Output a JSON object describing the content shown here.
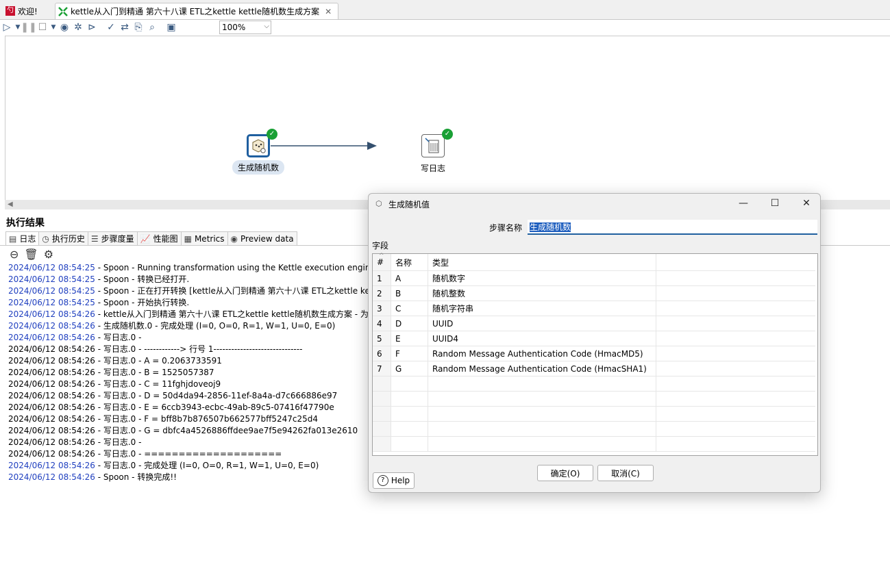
{
  "tabs": {
    "welcome": "欢迎!",
    "transformation": "kettle从入门到精通 第六十八课 ETL之kettle kettle随机数生成方案"
  },
  "toolbar": {
    "zoom": "100%"
  },
  "canvas": {
    "steps": [
      {
        "label": "生成随机数",
        "status": "ok"
      },
      {
        "label": "写日志",
        "status": "ok"
      }
    ]
  },
  "results": {
    "title": "执行结果",
    "tabs": [
      "日志",
      "执行历史",
      "步骤度量",
      "性能图",
      "Metrics",
      "Preview data"
    ],
    "log": [
      {
        "ts": "2024/06/12 08:54:25",
        "msg": " - Spoon - Running transformation using the Kettle execution engine",
        "blue": true
      },
      {
        "ts": "2024/06/12 08:54:25",
        "msg": " - Spoon - 转换已经打开.",
        "blue": true
      },
      {
        "ts": "2024/06/12 08:54:25",
        "msg": " - Spoon - 正在打开转换 [kettle从入门到精通 第六十八课 ETL之kettle kett",
        "blue": true
      },
      {
        "ts": "2024/06/12 08:54:25",
        "msg": " - Spoon - 开始执行转换.",
        "blue": true
      },
      {
        "ts": "2024/06/12 08:54:26",
        "msg": " - kettle从入门到精通 第六十八课 ETL之kettle kettle随机数生成方案 - 为了",
        "blue": true
      },
      {
        "ts": "2024/06/12 08:54:26",
        "msg": " - 生成随机数.0 - 完成处理 (I=0, O=0, R=1, W=1, U=0, E=0)",
        "blue": true
      },
      {
        "ts": "2024/06/12 08:54:26",
        "msg": " - 写日志.0 - ",
        "blue": true
      },
      {
        "ts": "2024/06/12 08:54:26",
        "msg": " - 写日志.0 - ------------> 行号 1------------------------------",
        "blue": false
      },
      {
        "ts": "2024/06/12 08:54:26",
        "msg": " - 写日志.0 - A = 0.2063733591",
        "blue": false
      },
      {
        "ts": "2024/06/12 08:54:26",
        "msg": " - 写日志.0 - B = 1525057387",
        "blue": false
      },
      {
        "ts": "2024/06/12 08:54:26",
        "msg": " - 写日志.0 - C = 11fghjdoveoj9",
        "blue": false
      },
      {
        "ts": "2024/06/12 08:54:26",
        "msg": " - 写日志.0 - D = 50d4da94-2856-11ef-8a4a-d7c666886e97",
        "blue": false
      },
      {
        "ts": "2024/06/12 08:54:26",
        "msg": " - 写日志.0 - E = 6ccb3943-ecbc-49ab-89c5-07416f47790e",
        "blue": false
      },
      {
        "ts": "2024/06/12 08:54:26",
        "msg": " - 写日志.0 - F = bff8b7b876507b662577bff5247c25d4",
        "blue": false
      },
      {
        "ts": "2024/06/12 08:54:26",
        "msg": " - 写日志.0 - G = dbfc4a4526886ffdee9ae7f5e94262fa013e2610",
        "blue": false
      },
      {
        "ts": "2024/06/12 08:54:26",
        "msg": " - 写日志.0 - ",
        "blue": false
      },
      {
        "ts": "2024/06/12 08:54:26",
        "msg": " - 写日志.0 - ====================",
        "blue": false
      },
      {
        "ts": "2024/06/12 08:54:26",
        "msg": " - 写日志.0 - 完成处理 (I=0, O=0, R=1, W=1, U=0, E=0)",
        "blue": true
      },
      {
        "ts": "2024/06/12 08:54:26",
        "msg": " - Spoon - 转换完成!!",
        "blue": true
      }
    ]
  },
  "dialog": {
    "title": "生成随机值",
    "step_name_label": "步骤名称",
    "step_name_value": "生成随机数",
    "fields_label": "字段",
    "columns": [
      "#",
      "名称",
      "类型"
    ],
    "rows": [
      {
        "num": "1",
        "name": "A",
        "type": "随机数字"
      },
      {
        "num": "2",
        "name": "B",
        "type": "随机整数"
      },
      {
        "num": "3",
        "name": "C",
        "type": "随机字符串"
      },
      {
        "num": "4",
        "name": "D",
        "type": "UUID"
      },
      {
        "num": "5",
        "name": "E",
        "type": "UUID4"
      },
      {
        "num": "6",
        "name": "F",
        "type": "Random Message Authentication Code (HmacMD5)"
      },
      {
        "num": "7",
        "name": "G",
        "type": "Random Message Authentication Code (HmacSHA1)"
      }
    ],
    "ok_label": "确定(O)",
    "cancel_label": "取消(C)",
    "help_label": "Help"
  }
}
